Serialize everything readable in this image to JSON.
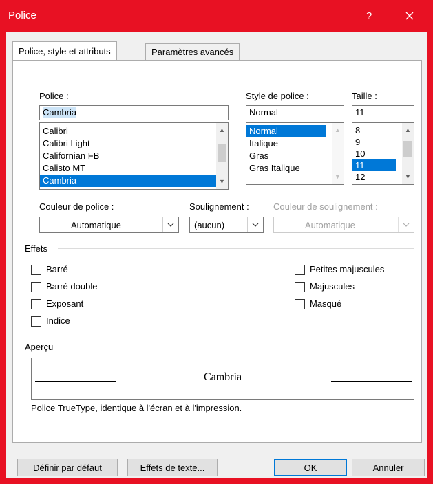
{
  "window": {
    "title": "Police",
    "help": "?",
    "close": "✕"
  },
  "tabs": [
    {
      "label": "Police, style et attributs"
    },
    {
      "label": "Paramètres avancés"
    }
  ],
  "font": {
    "label": "Police :",
    "value": "Cambria",
    "items": [
      "Calibri",
      "Calibri Light",
      "Californian FB",
      "Calisto MT",
      "Cambria"
    ],
    "selected": "Cambria"
  },
  "style": {
    "label": "Style de police :",
    "value": "Normal",
    "items": [
      "Normal",
      "Italique",
      "Gras",
      "Gras Italique"
    ],
    "selected": "Normal"
  },
  "size": {
    "label": "Taille :",
    "value": "11",
    "items": [
      "8",
      "9",
      "10",
      "11",
      "12"
    ],
    "selected": "11"
  },
  "color": {
    "label": "Couleur de police :",
    "value": "Automatique"
  },
  "underline": {
    "label": "Soulignement :",
    "value": "(aucun)"
  },
  "underline_color": {
    "label": "Couleur de soulignement :",
    "value": "Automatique"
  },
  "effects": {
    "label": "Effets",
    "left": [
      "Barré",
      "Barré double",
      "Exposant",
      "Indice"
    ],
    "right": [
      "Petites majuscules",
      "Majuscules",
      "Masqué"
    ]
  },
  "preview": {
    "label": "Aperçu",
    "text": "Cambria",
    "description": "Police TrueType, identique à l'écran et à l'impression."
  },
  "buttons": {
    "default": "Définir par défaut",
    "text_effects": "Effets de texte...",
    "ok": "OK",
    "cancel": "Annuler"
  }
}
